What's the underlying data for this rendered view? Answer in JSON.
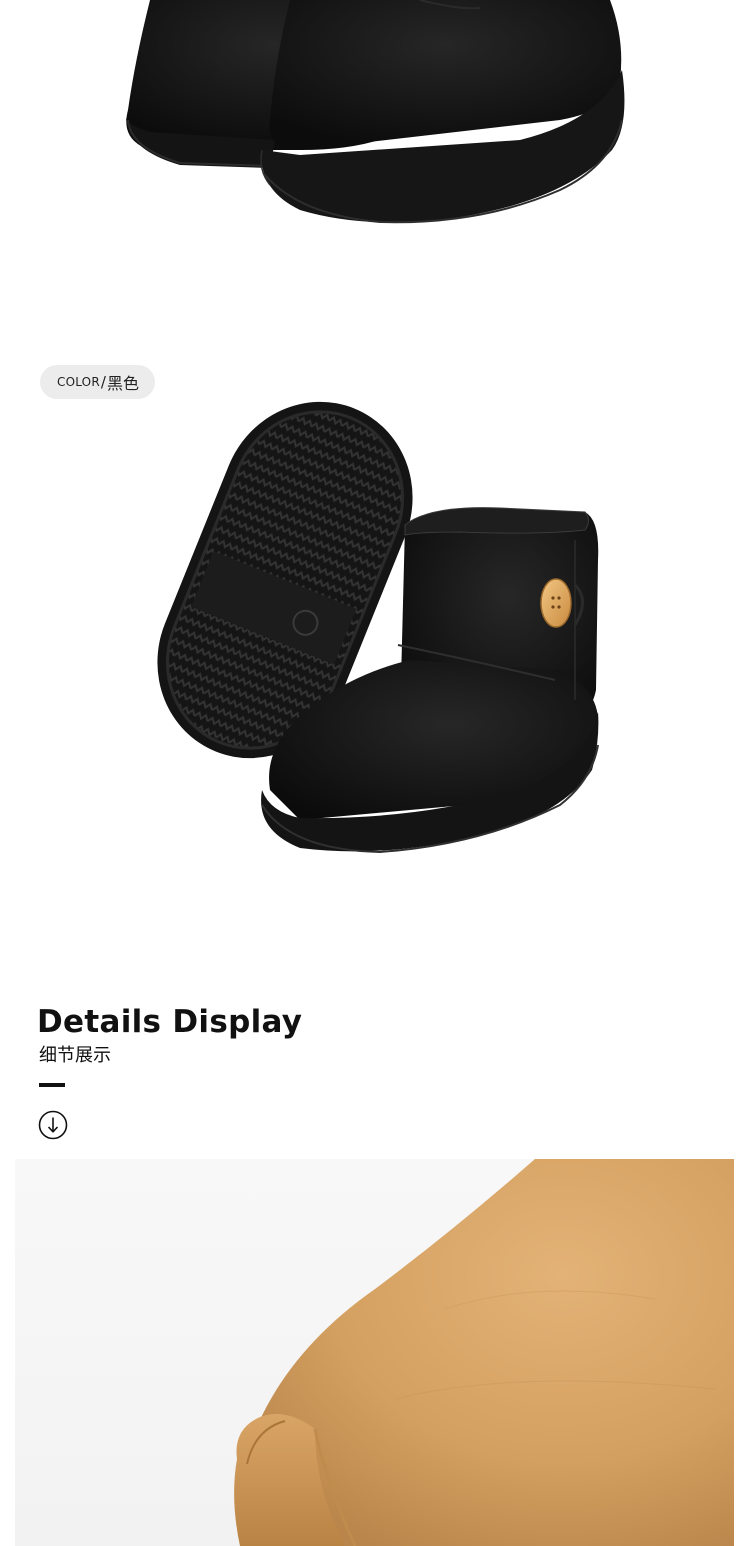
{
  "color_tag": {
    "label_en": "COLOR",
    "separator": "/",
    "label_zh": "黑色"
  },
  "details": {
    "title": "Details Display",
    "subtitle": "细节展示"
  },
  "icons": {
    "down": "arrow-down-circle-icon"
  },
  "colors": {
    "boot_black": "#131313",
    "boot_tan": "#d7a565",
    "tag_bg": "#ececec",
    "text": "#111111"
  }
}
